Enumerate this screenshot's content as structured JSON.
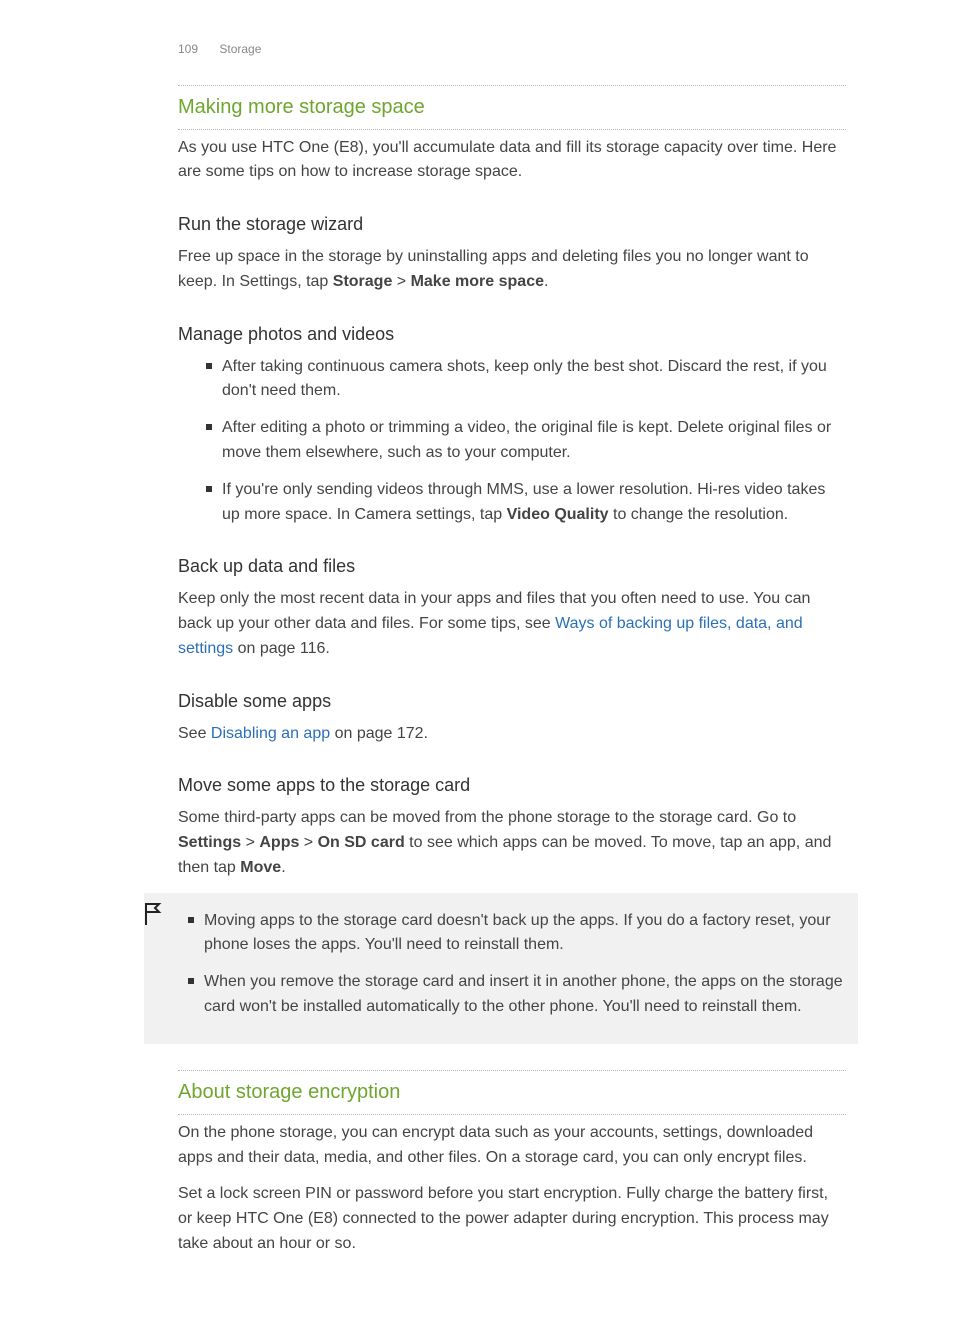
{
  "header": {
    "page_number": "109",
    "section_name": "Storage"
  },
  "s1": {
    "title": "Making more storage space",
    "intro": "As you use HTC One (E8), you'll accumulate data and fill its storage capacity over time. Here are some tips on how to increase storage space.",
    "h_wizard": "Run the storage wizard",
    "wizard_p_a": "Free up space in the storage by uninstalling apps and deleting files you no longer want to keep. In Settings, tap ",
    "wizard_b1": "Storage",
    "wizard_gt": " > ",
    "wizard_b2": "Make more space",
    "wizard_period": ".",
    "h_photos": "Manage photos and videos",
    "photos_li1": "After taking continuous camera shots, keep only the best shot. Discard the rest, if you don't need them.",
    "photos_li2": "After editing a photo or trimming a video, the original file is kept. Delete original files or move them elsewhere, such as to your computer.",
    "photos_li3_a": "If you're only sending videos through MMS, use a lower resolution. Hi-res video takes up more space. In Camera settings, tap ",
    "photos_li3_b": "Video Quality",
    "photos_li3_c": " to change the resolution.",
    "h_backup": "Back up data and files",
    "backup_a": "Keep only the most recent data in your apps and files that you often need to use. You can back up your other data and files. For some tips, see ",
    "backup_link": "Ways of backing up files, data, and settings",
    "backup_b": " on page 116.",
    "h_disable": "Disable some apps",
    "disable_a": "See ",
    "disable_link": "Disabling an app",
    "disable_b": " on page 172.",
    "h_move": "Move some apps to the storage card",
    "move_a": "Some third-party apps can be moved from the phone storage to the storage card. Go to ",
    "move_b1": "Settings",
    "move_gt1": " > ",
    "move_b2": "Apps",
    "move_gt2": " > ",
    "move_b3": "On SD card",
    "move_c": " to see which apps can be moved. To move, tap an app, and then tap ",
    "move_b4": "Move",
    "move_d": ".",
    "note_li1": "Moving apps to the storage card doesn't back up the apps. If you do a factory reset, your phone loses the apps. You'll need to reinstall them.",
    "note_li2": "When you remove the storage card and insert it in another phone, the apps on the storage card won't be installed automatically to the other phone. You'll need to reinstall them."
  },
  "s2": {
    "title": "About storage encryption",
    "p1": "On the phone storage, you can encrypt data such as your accounts, settings, downloaded apps and their data, media, and other files. On a storage card, you can only encrypt files.",
    "p2": "Set a lock screen PIN or password before you start encryption. Fully charge the battery first, or keep HTC One (E8) connected to the power adapter during encryption. This process may take about an hour or so."
  }
}
